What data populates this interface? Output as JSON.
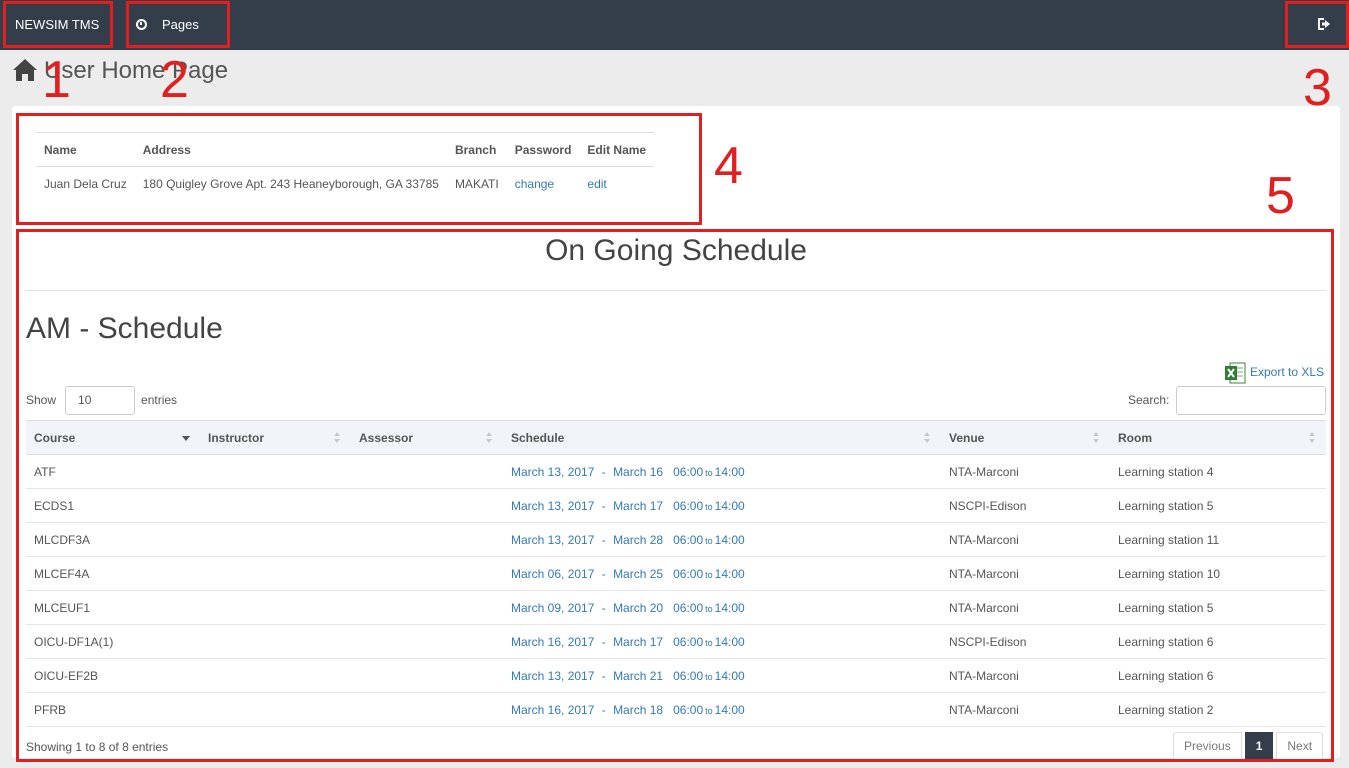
{
  "navbar": {
    "brand": "NEWSIM TMS",
    "pages_label": "Pages",
    "clock_icon": "clock-icon",
    "logout_icon": "sign-out-icon"
  },
  "page_title": "User Home Page",
  "user_table": {
    "headers": [
      "Name",
      "Address",
      "Branch",
      "Password",
      "Edit Name"
    ],
    "row": {
      "name": "Juan Dela Cruz",
      "address": "180 Quigley Grove Apt. 243 Heaneyborough, GA 33785",
      "branch": "MAKATI",
      "password_link": "change",
      "edit_link": "edit"
    }
  },
  "ongoing_title": "On Going Schedule",
  "am_title": "AM - Schedule",
  "export_label": "Export to XLS",
  "show_label": "Show",
  "entries_label": "entries",
  "show_value": "10",
  "search_label": "Search:",
  "columns": [
    "Course",
    "Instructor",
    "Assessor",
    "Schedule",
    "Venue",
    "Room"
  ],
  "rows": [
    {
      "course": "ATF",
      "start": "March 13, 2017",
      "end": "March 16",
      "from": "06:00",
      "to_word": "to",
      "until": "14:00",
      "venue": "NTA-Marconi",
      "room": "Learning station 4"
    },
    {
      "course": "ECDS1",
      "start": "March 13, 2017",
      "end": "March 17",
      "from": "06:00",
      "to_word": "to",
      "until": "14:00",
      "venue": "NSCPI-Edison",
      "room": "Learning station 5"
    },
    {
      "course": "MLCDF3A",
      "start": "March 13, 2017",
      "end": "March 28",
      "from": "06:00",
      "to_word": "to",
      "until": "14:00",
      "venue": "NTA-Marconi",
      "room": "Learning station 11"
    },
    {
      "course": "MLCEF4A",
      "start": "March 06, 2017",
      "end": "March 25",
      "from": "06:00",
      "to_word": "to",
      "until": "14:00",
      "venue": "NTA-Marconi",
      "room": "Learning station 10"
    },
    {
      "course": "MLCEUF1",
      "start": "March 09, 2017",
      "end": "March 20",
      "from": "06:00",
      "to_word": "to",
      "until": "14:00",
      "venue": "NTA-Marconi",
      "room": "Learning station 5"
    },
    {
      "course": "OICU-DF1A(1)",
      "start": "March 16, 2017",
      "end": "March 17",
      "from": "06:00",
      "to_word": "to",
      "until": "14:00",
      "venue": "NSCPI-Edison",
      "room": "Learning station 6"
    },
    {
      "course": "OICU-EF2B",
      "start": "March 13, 2017",
      "end": "March 21",
      "from": "06:00",
      "to_word": "to",
      "until": "14:00",
      "venue": "NTA-Marconi",
      "room": "Learning station 6"
    },
    {
      "course": "PFRB",
      "start": "March 16, 2017",
      "end": "March 18",
      "from": "06:00",
      "to_word": "to",
      "until": "14:00",
      "venue": "NTA-Marconi",
      "room": "Learning station 2"
    }
  ],
  "info": "Showing 1 to 8 of 8 entries",
  "pager": {
    "prev": "Previous",
    "current": "1",
    "next": "Next"
  },
  "annotations": [
    "1",
    "2",
    "3",
    "4",
    "5"
  ],
  "colors": {
    "navbar": "#333e4a",
    "link": "#337ab7",
    "annotation": "#e02020"
  }
}
